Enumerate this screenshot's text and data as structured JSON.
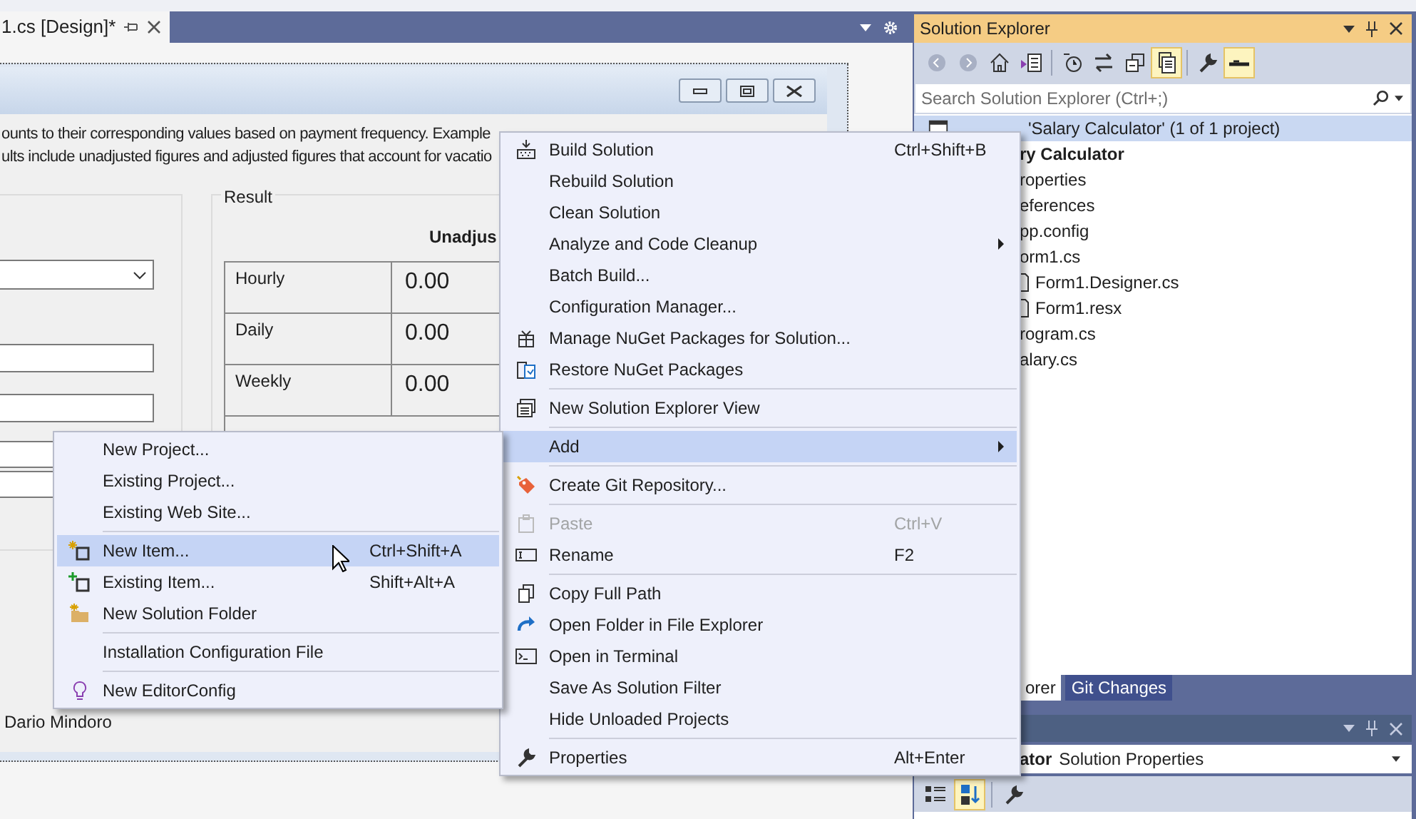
{
  "document_tab": {
    "title": "1.cs [Design]*",
    "selected": true
  },
  "form": {
    "description": [
      "ounts to their corresponding values based on payment frequency. Example",
      "ults include unadjusted figures and adjusted figures that account for vacatio"
    ],
    "result_group": {
      "title": "Result",
      "column_heading": "Unadjus",
      "rows": [
        {
          "label": "Hourly",
          "value": "0.00"
        },
        {
          "label": "Daily",
          "value": "0.00"
        },
        {
          "label": "Weekly",
          "value": "0.00"
        }
      ]
    },
    "footer": "Dario Mindoro"
  },
  "solution_explorer": {
    "title": "Solution Explorer",
    "toolbar": [
      {
        "active": false
      },
      {
        "active": false
      },
      {
        "active": false
      },
      {
        "active": false
      },
      {
        "active": false
      },
      {
        "active": false
      },
      {
        "active": false
      },
      {
        "active": true
      },
      {
        "active": false
      },
      {
        "active": true
      }
    ],
    "search": {
      "placeholder": "Search Solution Explorer (Ctrl+;)"
    },
    "tree": [
      {
        "bold": false,
        "label": "'Salary Calculator' (1 of 1 project)",
        "selected": true,
        "children": [
          {
            "bold": true,
            "label": "ry Calculator",
            "selected": false,
            "children": [
              {
                "bold": false,
                "label": "roperties",
                "selected": false
              },
              {
                "bold": false,
                "label": "eferences",
                "selected": false
              },
              {
                "bold": false,
                "label": "pp.config",
                "selected": false
              },
              {
                "bold": false,
                "label": "orm1.cs",
                "selected": false,
                "children": [
                  {
                    "bold": false,
                    "label": "Form1.Designer.cs",
                    "selected": false
                  },
                  {
                    "bold": false,
                    "label": "Form1.resx",
                    "selected": false
                  }
                ]
              },
              {
                "bold": false,
                "label": "rogram.cs",
                "selected": false
              },
              {
                "bold": false,
                "label": "alary.cs",
                "selected": false
              }
            ]
          }
        ]
      }
    ],
    "tabs": [
      {
        "label": "orer",
        "selected": true
      },
      {
        "label": "Git Changes",
        "selected": false
      }
    ]
  },
  "properties": {
    "object": "ator",
    "type": "Solution Properties",
    "toolbar": [
      {
        "active": false
      },
      {
        "active": true
      },
      {
        "active": false
      }
    ]
  },
  "context_menu": {
    "items": [
      {
        "kind": "item",
        "label": "Build Solution",
        "shortcut": "Ctrl+Shift+B",
        "submenu": false,
        "disabled": false,
        "selected": false
      },
      {
        "kind": "item",
        "label": "Rebuild Solution",
        "submenu": false,
        "disabled": false,
        "selected": false
      },
      {
        "kind": "item",
        "label": "Clean Solution",
        "submenu": false,
        "disabled": false,
        "selected": false
      },
      {
        "kind": "item",
        "label": "Analyze and Code Cleanup",
        "submenu": true,
        "disabled": false,
        "selected": false
      },
      {
        "kind": "item",
        "label": "Batch Build...",
        "submenu": false,
        "disabled": false,
        "selected": false
      },
      {
        "kind": "item",
        "label": "Configuration Manager...",
        "submenu": false,
        "disabled": false,
        "selected": false
      },
      {
        "kind": "item",
        "label": "Manage NuGet Packages for Solution...",
        "submenu": false,
        "disabled": false,
        "selected": false
      },
      {
        "kind": "item",
        "label": "Restore NuGet Packages",
        "submenu": false,
        "disabled": false,
        "selected": false
      },
      {
        "kind": "separator"
      },
      {
        "kind": "item",
        "label": "New Solution Explorer View",
        "submenu": false,
        "disabled": false,
        "selected": false
      },
      {
        "kind": "separator"
      },
      {
        "kind": "item",
        "label": "Add",
        "submenu": true,
        "disabled": false,
        "selected": true
      },
      {
        "kind": "separator"
      },
      {
        "kind": "item",
        "label": "Create Git Repository...",
        "submenu": false,
        "disabled": false,
        "selected": false
      },
      {
        "kind": "separator"
      },
      {
        "kind": "item",
        "label": "Paste",
        "shortcut": "Ctrl+V",
        "submenu": false,
        "disabled": true,
        "selected": false
      },
      {
        "kind": "item",
        "label": "Rename",
        "shortcut": "F2",
        "submenu": false,
        "disabled": false,
        "selected": false
      },
      {
        "kind": "separator"
      },
      {
        "kind": "item",
        "label": "Copy Full Path",
        "submenu": false,
        "disabled": false,
        "selected": false
      },
      {
        "kind": "item",
        "label": "Open Folder in File Explorer",
        "submenu": false,
        "disabled": false,
        "selected": false
      },
      {
        "kind": "item",
        "label": "Open in Terminal",
        "submenu": false,
        "disabled": false,
        "selected": false
      },
      {
        "kind": "item",
        "label": "Save As Solution Filter",
        "submenu": false,
        "disabled": false,
        "selected": false
      },
      {
        "kind": "item",
        "label": "Hide Unloaded Projects",
        "submenu": false,
        "disabled": false,
        "selected": false
      },
      {
        "kind": "separator"
      },
      {
        "kind": "item",
        "label": "Properties",
        "shortcut": "Alt+Enter",
        "submenu": false,
        "disabled": false,
        "selected": false
      }
    ]
  },
  "add_submenu": {
    "items": [
      {
        "kind": "item",
        "label": "New Project...",
        "submenu": false,
        "disabled": false,
        "selected": false
      },
      {
        "kind": "item",
        "label": "Existing Project...",
        "submenu": false,
        "disabled": false,
        "selected": false
      },
      {
        "kind": "item",
        "label": "Existing Web Site...",
        "submenu": false,
        "disabled": false,
        "selected": false
      },
      {
        "kind": "separator"
      },
      {
        "kind": "item",
        "label": "New Item...",
        "shortcut": "Ctrl+Shift+A",
        "submenu": false,
        "disabled": false,
        "selected": true
      },
      {
        "kind": "item",
        "label": "Existing Item...",
        "shortcut": "Shift+Alt+A",
        "submenu": false,
        "disabled": false,
        "selected": false
      },
      {
        "kind": "item",
        "label": "New Solution Folder",
        "submenu": false,
        "disabled": false,
        "selected": false
      },
      {
        "kind": "separator"
      },
      {
        "kind": "item",
        "label": "Installation Configuration File",
        "submenu": false,
        "disabled": false,
        "selected": false
      },
      {
        "kind": "separator"
      },
      {
        "kind": "item",
        "label": "New EditorConfig",
        "submenu": false,
        "disabled": false,
        "selected": false
      }
    ]
  }
}
